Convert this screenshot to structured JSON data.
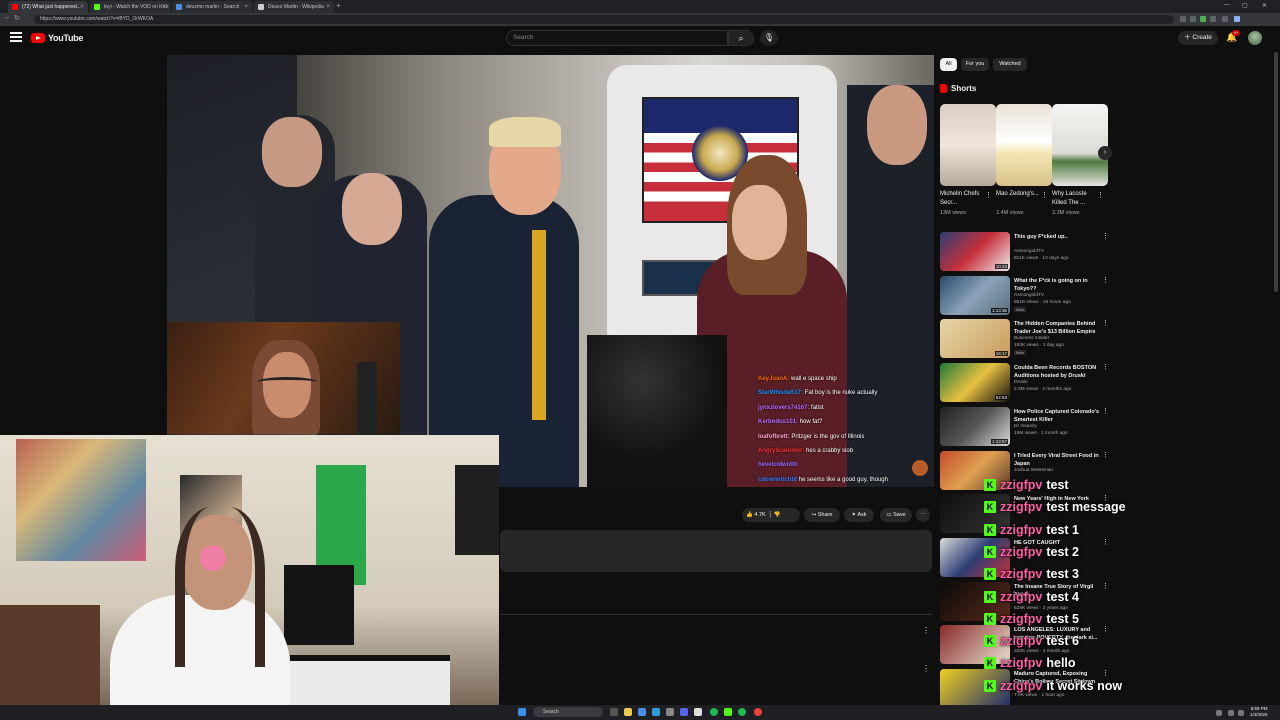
{
  "browser": {
    "tabs": [
      {
        "label": "(72) What just happened...",
        "color": "#ff0000"
      },
      {
        "label": "toyi - Watch the VOD on Kick",
        "color": "#53fc18"
      },
      {
        "label": "deuxmo martin - Search",
        "color": "#4a90e2"
      },
      {
        "label": "Deuxo Martin - Wikipedia",
        "color": "#cccccc"
      }
    ],
    "url": "https://www.youtube.com/watch?v=lBYD_OrWKOA",
    "new_tab": "+"
  },
  "header": {
    "logo_text": "YouTube",
    "search_placeholder": "Search",
    "create_label": "Create",
    "bell_badge": "9+"
  },
  "video_chat": [
    {
      "user": "KeyJuanA:",
      "msg": "wall e space ship",
      "color": "#ff6a00"
    },
    {
      "user": "StarWhistle517:",
      "msg": "Fat boy is the nuke actually",
      "color": "#1e90ff"
    },
    {
      "user": "jynxzlovers74167:",
      "msg": "fatist",
      "color": "#b86bff"
    },
    {
      "user": "Kerbodus101:",
      "msg": "how fat?",
      "color": "#b86bff"
    },
    {
      "user": "loafofbrett:",
      "msg": "Pritzger is the gov of Illinois",
      "color": "#ff9ecf"
    },
    {
      "user": "AngryScammer:",
      "msg": "hes a crabby slob",
      "color": "#ff3030"
    },
    {
      "user": "hevelcidwidth",
      "msg": "",
      "color": "#9a6bff"
    },
    {
      "user": "cdownnitchtit",
      "msg": "he seems like a good guy, though",
      "color": "#3b7bff"
    }
  ],
  "actions": {
    "likes": "4.7K",
    "share": "Share",
    "ask": "Ask",
    "save": "Save"
  },
  "chips": [
    "All",
    "For you",
    "Watched"
  ],
  "shorts": {
    "heading": "Shorts",
    "items": [
      {
        "title": "Michelin Chefs Secr...",
        "views": "13M views"
      },
      {
        "title": "Mao Zedong's...",
        "views": "2.4M views"
      },
      {
        "title": "Why Lacoste Killed The ...",
        "views": "3.3M views"
      }
    ]
  },
  "recommendations": [
    {
      "title": "This guy F*cked up..",
      "channel": "AsmongoldTV",
      "views": "811K views · 13 days ago",
      "duration": "10:23",
      "new": ""
    },
    {
      "title": "What the F*ck is going on in Tokyo??",
      "channel": "AsmongoldTV",
      "views": "851K views · 16 hours ago",
      "duration": "1:13:36",
      "new": "New"
    },
    {
      "title": "The Hidden Companies Behind Trader Joe's $13 Billion Empire",
      "channel": "Business Insider",
      "views": "193K views · 1 day ago",
      "duration": "16:17",
      "new": "New"
    },
    {
      "title": "Coulda Been Records BOSTON Auditions hosted by Druski",
      "channel": "Druski",
      "views": "2.3M views · 2 months ago",
      "duration": "52:53",
      "new": ""
    },
    {
      "title": "How Police Captured Colorado's Smartest Killer",
      "channel": "Dr Insanity",
      "views": "15M views · 1 month ago",
      "duration": "1:13:57",
      "new": ""
    },
    {
      "title": "I Tried Every Viral Street Food in Japan",
      "channel": "Joshua Weissman",
      "views": "",
      "duration": "",
      "new": ""
    },
    {
      "title": "New Years' High in New York",
      "channel": "",
      "views": "",
      "duration": "",
      "new": ""
    },
    {
      "title": "HE GOT CAUGHT",
      "channel": "",
      "views": "",
      "duration": "",
      "new": ""
    },
    {
      "title": "The Insane True Story of Virgil Abloh",
      "channel": "",
      "views": "528K views · 2 years ago",
      "duration": "",
      "new": ""
    },
    {
      "title": "LOS ANGELES: LUXURY and extreme POVERTY, the dark si...",
      "channel": "",
      "views": "320K views · 1 month ago",
      "duration": "",
      "new": ""
    },
    {
      "title": "Maduro Captured, Exposing China's Bolivar Secret Sitdown",
      "channel": "",
      "views": "7.9K views · 1 hour ago",
      "duration": "",
      "new": ""
    }
  ],
  "test_chat": [
    {
      "user": "zzigfpv",
      "msg": "test"
    },
    {
      "user": "zzigfpv",
      "msg": "test message"
    },
    {
      "user": "zzigfpv",
      "msg": "test 1"
    },
    {
      "user": "zzigfpv",
      "msg": "test 2"
    },
    {
      "user": "zzigfpv",
      "msg": "test 3"
    },
    {
      "user": "zzigfpv",
      "msg": "test 4"
    },
    {
      "user": "zzigfpv",
      "msg": "test 5"
    },
    {
      "user": "zzigfpv",
      "msg": "test 6"
    },
    {
      "user": "zzigfpv",
      "msg": "hello"
    },
    {
      "user": "zzigfpv",
      "msg": "it works now"
    }
  ],
  "taskbar": {
    "search": "Search",
    "time": "8:59 PM",
    "date": "1/4/2026"
  },
  "colors": {
    "kick_green": "#53fc18",
    "youtube_red": "#ff0000",
    "chat_user_pink": "#ff5fa8"
  }
}
